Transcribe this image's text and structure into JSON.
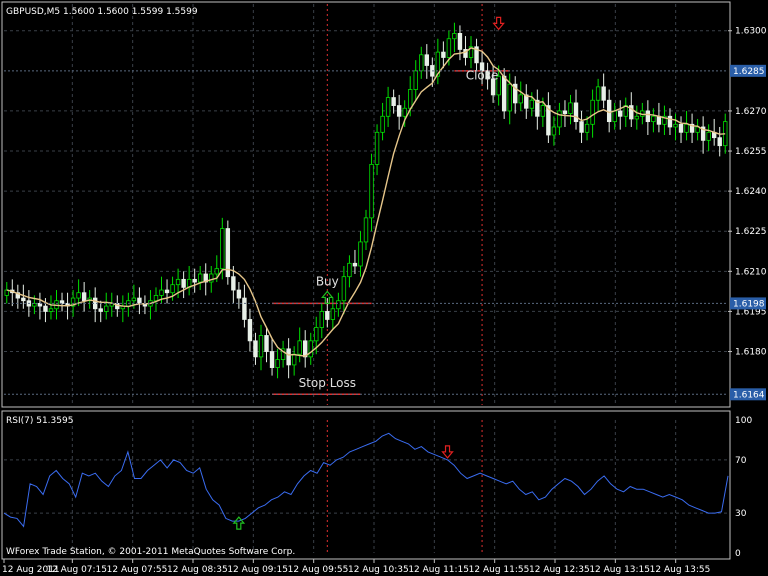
{
  "header": {
    "symbol_info": "GBPUSD,M5  1.5600 1.5600 1.5599 1.5599",
    "rsi_label": "RSI(7) 51.3595",
    "copyright": "WForex Trade Station, © 2001-2011 MetaQuotes Software Corp."
  },
  "colors": {
    "background": "#000000",
    "grid": "#3a4048",
    "frame": "#c0c0c0",
    "candle_up": "#00e000",
    "candle_down": "#e8f0e8",
    "ma": "#e6c68a",
    "rsi": "#3a6cf0",
    "level_line": "#e03030",
    "price_tag": "#2a5ea8",
    "arrow_up": "#20c020",
    "arrow_down": "#e02020"
  },
  "chart_data": [
    {
      "type": "candlestick",
      "symbol": "GBPUSD",
      "timeframe": "M5",
      "price_labels": [
        "1.6300",
        "1.6285",
        "1.6270",
        "1.6255",
        "1.6240",
        "1.6225",
        "1.6210",
        "1.6195",
        "1.6180",
        "1.6164",
        "1.6198"
      ],
      "y_ticks": [
        1.63,
        1.627,
        1.6255,
        1.624,
        1.6225,
        1.621,
        1.6195,
        1.618
      ],
      "ylim": [
        1.616,
        1.631
      ],
      "current_price": "1.6285",
      "highlighted_prices": [
        "1.6198",
        "1.6164"
      ],
      "x_labels": [
        "12 Aug 2011",
        "12 Aug 07:15",
        "12 Aug 07:55",
        "12 Aug 08:35",
        "12 Aug 09:15",
        "12 Aug 09:55",
        "12 Aug 10:35",
        "12 Aug 11:15",
        "12 Aug 11:55",
        "12 Aug 12:35",
        "12 Aug 13:15",
        "12 Aug 13:55"
      ],
      "annotations": [
        {
          "text": "Buy",
          "price": 1.6204
        },
        {
          "text": "Stop Loss",
          "price": 1.6166
        },
        {
          "text": "Close",
          "price": 1.6281
        }
      ],
      "levels": {
        "buy": 1.6198,
        "stop_loss": 1.6164,
        "close": 1.6285
      },
      "close": [
        1.6203,
        1.6202,
        1.62,
        1.6199,
        1.6197,
        1.6198,
        1.6197,
        1.6195,
        1.6196,
        1.6199,
        1.6198,
        1.6197,
        1.62,
        1.6202,
        1.6199,
        1.62,
        1.6196,
        1.6195,
        1.6197,
        1.6198,
        1.6196,
        1.6197,
        1.6199,
        1.62,
        1.6198,
        1.6197,
        1.6199,
        1.6201,
        1.6203,
        1.6202,
        1.6205,
        1.6207,
        1.6204,
        1.6207,
        1.6206,
        1.6209,
        1.6206,
        1.6209,
        1.6211,
        1.6226,
        1.6208,
        1.6203,
        1.62,
        1.6192,
        1.6184,
        1.6178,
        1.6186,
        1.618,
        1.6174,
        1.6177,
        1.6181,
        1.6175,
        1.6179,
        1.6184,
        1.6178,
        1.6184,
        1.6189,
        1.6195,
        1.6192,
        1.6196,
        1.6199,
        1.6208,
        1.6213,
        1.6212,
        1.6221,
        1.623,
        1.625,
        1.6262,
        1.6268,
        1.6275,
        1.6272,
        1.6268,
        1.6271,
        1.6278,
        1.6285,
        1.6291,
        1.6287,
        1.6283,
        1.6292,
        1.629,
        1.6297,
        1.6299,
        1.6293,
        1.629,
        1.6294,
        1.6288,
        1.6285,
        1.6282,
        1.6276,
        1.6283,
        1.627,
        1.628,
        1.6273,
        1.6276,
        1.6271,
        1.6274,
        1.6268,
        1.6272,
        1.6261,
        1.6264,
        1.627,
        1.6269,
        1.6273,
        1.6266,
        1.6262,
        1.6265,
        1.6274,
        1.6279,
        1.6274,
        1.6266,
        1.627,
        1.6268,
        1.6272,
        1.6267,
        1.6268,
        1.627,
        1.6266,
        1.6268,
        1.6265,
        1.6268,
        1.6264,
        1.6265,
        1.6262,
        1.6265,
        1.6262,
        1.6264,
        1.6259,
        1.6262,
        1.626,
        1.6257,
        1.6266
      ]
    },
    {
      "type": "line",
      "name": "RSI(7)",
      "y_ticks": [
        100,
        70,
        30,
        0
      ],
      "ylim": [
        0,
        100
      ],
      "values": [
        30,
        27,
        26,
        20,
        52,
        50,
        44,
        58,
        62,
        56,
        52,
        42,
        60,
        58,
        60,
        54,
        50,
        58,
        62,
        76,
        56,
        56,
        62,
        66,
        70,
        64,
        70,
        68,
        62,
        60,
        64,
        48,
        40,
        36,
        26,
        24,
        24,
        26,
        30,
        34,
        36,
        40,
        42,
        46,
        44,
        52,
        58,
        62,
        60,
        68,
        66,
        70,
        72,
        76,
        78,
        80,
        82,
        84,
        88,
        90,
        86,
        84,
        82,
        78,
        80,
        76,
        74,
        72,
        70,
        66,
        60,
        56,
        58,
        60,
        58,
        56,
        54,
        52,
        54,
        48,
        44,
        46,
        40,
        42,
        48,
        52,
        56,
        54,
        50,
        44,
        48,
        54,
        58,
        52,
        48,
        46,
        50,
        48,
        48,
        46,
        44,
        42,
        44,
        42,
        40,
        36,
        34,
        32,
        30,
        30,
        31,
        58
      ]
    }
  ]
}
